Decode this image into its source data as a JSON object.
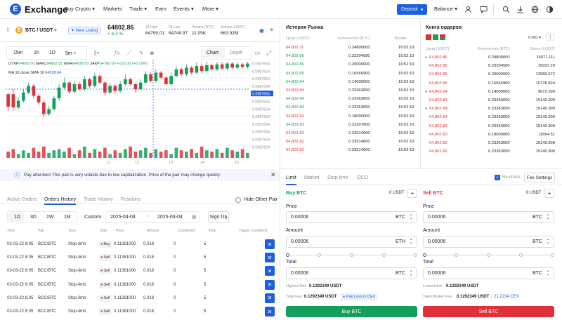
{
  "nav": {
    "logo_text": "Exchange",
    "items": [
      "Buy Crypto",
      "Markets",
      "Trade",
      "Earn",
      "Events",
      "More"
    ],
    "deposit_label": "Deposit",
    "balance_label": "Balance"
  },
  "ticker": {
    "pair": "BTC / USDT",
    "badge": "New Listing",
    "price": "64802.86",
    "change": "+ 6.3 %",
    "stats": [
      {
        "label": "24 High",
        "value": "64790.01"
      },
      {
        "label": "24 Low",
        "value": "64749.97"
      },
      {
        "label": "Volume (BTC)",
        "value": "11.05K"
      },
      {
        "label": "Volume (USDT)",
        "value": "663.92M"
      }
    ]
  },
  "chart_toolbar": {
    "intervals": [
      "15m",
      "1h",
      "1D",
      "5m"
    ],
    "tabs": [
      "Chart",
      "Depth"
    ]
  },
  "chart_info": {
    "ohlc_line": [
      {
        "k": "ОТКР",
        "v": "64660.00"
      },
      {
        "k": "МАКС",
        "v": "64802.81"
      },
      {
        "k": "МИН",
        "v": "64656.00"
      },
      {
        "k": "ЗАКР",
        "v": "64780.00"
      },
      {
        "k": "",
        "v": "+120.00 (+0.19%)"
      }
    ],
    "ma_label": "MA 10 close SMA 10",
    "ma_value": "64528.84"
  },
  "chart_data": {
    "type": "candlestick",
    "y_ticks": [
      "0.0987654",
      "0.0987654",
      "0.0987654",
      "0.0987654",
      "0.0987655",
      "0.0987654",
      "0.0987654",
      "0.0987654",
      "0.0987654",
      "0.0987654",
      "0.0987654",
      "0.0987654"
    ],
    "x_ticks": [
      "11",
      "12",
      "13",
      "14",
      "15"
    ],
    "candles": [
      [
        0.45,
        0.6,
        0.4,
        0.62,
        0
      ],
      [
        0.6,
        0.44,
        0.66,
        0.4,
        0
      ],
      [
        0.44,
        0.52,
        0.42,
        0.56,
        1
      ],
      [
        0.52,
        0.62,
        0.5,
        0.66,
        1
      ],
      [
        0.62,
        0.7,
        0.6,
        0.74,
        1
      ],
      [
        0.7,
        0.58,
        0.72,
        0.55,
        0
      ],
      [
        0.58,
        0.5,
        0.6,
        0.48,
        0
      ],
      [
        0.5,
        0.36,
        0.52,
        0.32,
        0
      ],
      [
        0.36,
        0.42,
        0.34,
        0.46,
        1
      ],
      [
        0.42,
        0.55,
        0.4,
        0.58,
        1
      ],
      [
        0.55,
        0.68,
        0.52,
        0.72,
        1
      ],
      [
        0.68,
        0.74,
        0.66,
        0.8,
        1
      ],
      [
        0.74,
        0.63,
        0.76,
        0.6,
        0
      ],
      [
        0.63,
        0.72,
        0.61,
        0.76,
        1
      ],
      [
        0.72,
        0.66,
        0.75,
        0.64,
        0
      ],
      [
        0.66,
        0.78,
        0.64,
        0.82,
        1
      ],
      [
        0.78,
        0.7,
        0.8,
        0.67,
        0
      ],
      [
        0.7,
        0.82,
        0.68,
        0.86,
        1
      ],
      [
        0.82,
        0.74,
        0.84,
        0.72,
        0
      ],
      [
        0.74,
        0.62,
        0.76,
        0.58,
        0
      ],
      [
        0.62,
        0.7,
        0.6,
        0.74,
        1
      ],
      [
        0.7,
        0.64,
        0.72,
        0.6,
        0
      ],
      [
        0.64,
        0.72,
        0.62,
        0.76,
        1
      ],
      [
        0.72,
        0.78,
        0.7,
        0.84,
        1
      ],
      [
        0.78,
        0.72,
        0.8,
        0.7,
        0
      ],
      [
        0.72,
        0.66,
        0.74,
        0.62,
        0
      ],
      [
        0.66,
        0.74,
        0.64,
        0.78,
        1
      ],
      [
        0.74,
        0.84,
        0.72,
        0.88,
        1
      ],
      [
        0.84,
        0.76,
        0.86,
        0.74,
        0
      ],
      [
        0.76,
        0.86,
        0.74,
        0.9,
        1
      ],
      [
        0.86,
        0.8,
        0.88,
        0.78,
        0
      ],
      [
        0.8,
        0.72,
        0.82,
        0.7,
        0
      ],
      [
        0.72,
        0.82,
        0.7,
        0.86,
        1
      ],
      [
        0.82,
        0.9,
        0.8,
        0.94,
        1
      ],
      [
        0.9,
        0.84,
        0.92,
        0.82,
        0
      ],
      [
        0.84,
        0.92,
        0.82,
        0.96,
        1
      ],
      [
        0.92,
        0.86,
        0.94,
        0.84,
        0
      ],
      [
        0.86,
        0.94,
        0.84,
        0.98,
        1
      ],
      [
        0.94,
        0.88,
        0.97,
        0.86,
        0
      ],
      [
        0.88,
        0.95,
        0.86,
        0.99,
        1
      ],
      [
        0.95,
        0.9,
        0.97,
        0.88,
        0
      ],
      [
        0.9,
        0.96,
        0.88,
        0.99,
        1
      ],
      [
        0.96,
        0.91,
        0.98,
        0.89,
        0
      ],
      [
        0.91,
        0.97,
        0.89,
        0.99,
        1
      ],
      [
        0.97,
        0.92,
        0.99,
        0.9,
        0
      ],
      [
        0.92,
        0.96,
        0.9,
        0.99,
        1
      ],
      [
        0.96,
        0.93,
        0.98,
        0.91,
        0
      ],
      [
        0.93,
        0.97,
        0.91,
        0.99,
        1
      ]
    ],
    "volumes": [
      0.5,
      0.7,
      0.3,
      0.6,
      0.4,
      0.8,
      0.5,
      0.9,
      0.4,
      0.6,
      0.7,
      0.5,
      0.8,
      0.3,
      0.6,
      0.9,
      0.4,
      0.7,
      0.5,
      0.8,
      0.3,
      0.6,
      0.4,
      0.7,
      0.9,
      0.5,
      0.6,
      0.8,
      0.4,
      0.7,
      0.5,
      0.6,
      0.3,
      0.8,
      0.6,
      0.5,
      0.7,
      0.4,
      0.9,
      0.6,
      0.5,
      0.7,
      0.4,
      0.8,
      0.6,
      0.5,
      0.7,
      0.4
    ]
  },
  "notice": "Pay attention! This pair is very volatile due to low capitalization. Price of the pair may change quickly.",
  "orders_tabs": {
    "tabs": [
      "Active Orders",
      "Orders History",
      "Trade History",
      "Positions"
    ],
    "hide_label": "Hide Other Pair",
    "periods": [
      "1D",
      "3D",
      "1W",
      "1M"
    ],
    "custom_label": "Custom",
    "date_from": "2025-04-04",
    "date_to": "2025-04-04",
    "signup_label": "Sign Up",
    "columns": [
      "Time",
      "Pair",
      "Type",
      "Side",
      "Price",
      "Amount",
      "Completed",
      "Total",
      "Trigger Conditions"
    ],
    "rows": [
      {
        "time": "03-03-22 8:05",
        "pair": "BCC/BTC",
        "type": "Stop-limit",
        "side": "Buy",
        "price": "0.11381000",
        "amount": "0.018",
        "completed": "0",
        "total": "5"
      },
      {
        "time": "03-03-22 8:05",
        "pair": "BCC/BTC",
        "type": "Stop-limit",
        "side": "Sell",
        "price": "0.11381000",
        "amount": "0.018",
        "completed": "0",
        "total": "5"
      },
      {
        "time": "03-03-22 8:05",
        "pair": "BCC/BTC",
        "type": "Stop-limit",
        "side": "Sell",
        "price": "0.11381000",
        "amount": "0.018",
        "completed": "0",
        "total": "5"
      },
      {
        "time": "03-03-22 8:05",
        "pair": "BCC/BTC",
        "type": "Stop-limit",
        "side": "Sell",
        "price": "0.11381000",
        "amount": "0.018",
        "completed": "0",
        "total": "5"
      },
      {
        "time": "03-03-22 8:05",
        "pair": "BCC/BTC",
        "type": "Stop-limit",
        "side": "Sell",
        "price": "0.11381000",
        "amount": "0.018",
        "completed": "0",
        "total": "5"
      },
      {
        "time": "03-03-22 8:05",
        "pair": "BCC/BTC",
        "type": "Stop-limit",
        "side": "Sell",
        "price": "0.11381000",
        "amount": "0.018",
        "completed": "0",
        "total": "5"
      }
    ]
  },
  "market_history": {
    "title": "История Рынка",
    "columns": [
      "Цена (USDT)",
      "Количество (BTC)",
      "Время"
    ],
    "rows": [
      {
        "price": "64,802.11",
        "qty": "0.24800000",
        "time": "16:52:19",
        "side": "red"
      },
      {
        "price": "64,802.86",
        "qty": "0.23204580",
        "time": "16:52:19",
        "side": "green"
      },
      {
        "price": "64,802.86",
        "qty": "0.20000000",
        "time": "16:52:19",
        "side": "green"
      },
      {
        "price": "64,802.85",
        "qty": "0.16566900",
        "time": "16:52:19",
        "side": "green"
      },
      {
        "price": "64,802.84",
        "qty": "0.14000000",
        "time": "16:52:19",
        "side": "green"
      },
      {
        "price": "64,802.84",
        "qty": "0.23363650",
        "time": "16:52:19",
        "side": "red"
      },
      {
        "price": "64,802.84",
        "qty": "0.23363650",
        "time": "16:52:19",
        "side": "green"
      },
      {
        "price": "64,802.84",
        "qty": "0.23363650",
        "time": "16:52:19",
        "side": "green"
      },
      {
        "price": "64,802.83",
        "qty": "0.18000000",
        "time": "16:52:19",
        "side": "red"
      },
      {
        "price": "64,802.83",
        "qty": "0.23307600",
        "time": "16:52:19",
        "side": "green"
      },
      {
        "price": "64,802.82",
        "qty": "0.23514000",
        "time": "16:52:19",
        "side": "red"
      },
      {
        "price": "64,802.82",
        "qty": "0.23514000",
        "time": "16:52:19",
        "side": "red"
      },
      {
        "price": "64,802.82",
        "qty": "0.23514000",
        "time": "16:52:19",
        "side": "red"
      }
    ]
  },
  "order_book": {
    "title": "Книга ордеров",
    "precision": "0.001",
    "columns": [
      "Цена (USDT)",
      "Количество (BTC)",
      "Всего (USDT)"
    ],
    "rows": [
      {
        "price": "64,802.86",
        "qty": "0.24800000",
        "total": "16071.111",
        "side": "red",
        "mark": true
      },
      {
        "price": "64,802.86",
        "qty": "0.23204580",
        "total": "15037.20",
        "side": "red",
        "mark": false
      },
      {
        "price": "64,802.85",
        "qty": "0.20000000",
        "total": "12960.572",
        "side": "red",
        "mark": false
      },
      {
        "price": "64,802.85",
        "qty": "0.16566900",
        "total": "10735.824",
        "side": "red",
        "mark": false
      },
      {
        "price": "64,802.84",
        "qty": "0.14000000",
        "total": "9072.399",
        "side": "red",
        "mark": true
      },
      {
        "price": "64,802.84",
        "qty": "0.23363650",
        "total": "15140.309",
        "side": "red",
        "mark": false
      },
      {
        "price": "64,802.84",
        "qty": "0.23363650",
        "total": "15140.309",
        "side": "red",
        "mark": true
      },
      {
        "price": "64,802.84",
        "qty": "0.23363650",
        "total": "15140.309",
        "side": "red",
        "mark": false
      },
      {
        "price": "64,802.84",
        "qty": "0.23363650",
        "total": "15140.309",
        "side": "red",
        "mark": false
      },
      {
        "price": "64,802.83",
        "qty": "0.18000000",
        "total": "11664.51",
        "side": "red",
        "mark": false
      },
      {
        "price": "64,802.83",
        "qty": "0.23363650",
        "total": "15140.309",
        "side": "red",
        "mark": false
      },
      {
        "price": "64,802.82",
        "qty": "0.23363650",
        "total": "15140.309",
        "side": "red",
        "mark": false
      }
    ]
  },
  "trade_form": {
    "tabs": [
      "Limit",
      "Market",
      "Stop-limit",
      "OCO"
    ],
    "recheck_label": "Re-check",
    "fee_settings_label": "Fee Settings",
    "buy": {
      "title": "Buy BTC",
      "balance": "0 USDT",
      "price_label": "Price",
      "price": "0.00006",
      "price_unit": "BTC",
      "amount_label": "Amount",
      "amount": "0.00006",
      "amount_unit": "ETH",
      "total_label": "Total",
      "total": "0.00006",
      "total_unit": "BTC",
      "best_label": "Highest Bid",
      "best_value": "0.1292349 USDT",
      "fee_label": "Total Fee:",
      "fee_value": "0.1292349 USDT",
      "fee_badge": "Pay Less in CEX",
      "submit_label": "Buy BTC"
    },
    "sell": {
      "title": "Sell BTC",
      "balance": "0 USDT",
      "price_label": "Price",
      "price": "0.00006",
      "price_unit": "BTC",
      "amount_label": "Amount",
      "amount": "0.00006",
      "amount_unit": "BTC",
      "total_label": "Total",
      "total": "0.00006",
      "total_unit": "BTC",
      "best_label": "Lowest Ask",
      "best_value": "0.1292349 USDT",
      "fee_label": "Taker/Maker Fee",
      "fee_value": "0.1292349 USDT",
      "fee_badge": "21.2234 CEX",
      "submit_label": "Sell BTC"
    }
  },
  "colors": {
    "accent": "#1d5fe0",
    "buy": "#14a05a",
    "sell": "#e0303a"
  }
}
